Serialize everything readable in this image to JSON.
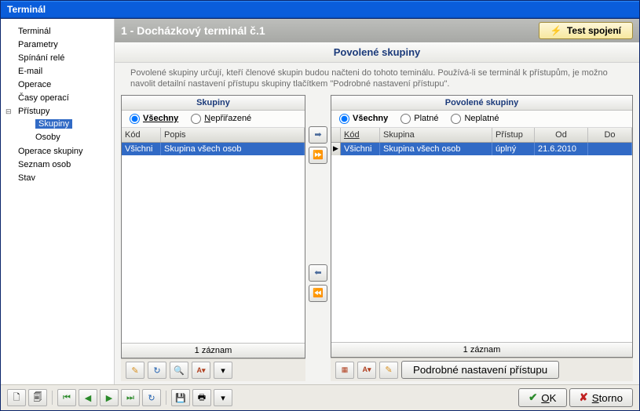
{
  "window_title": "Terminál",
  "sidebar": {
    "items": [
      {
        "label": "Terminál"
      },
      {
        "label": "Parametry"
      },
      {
        "label": "Spínání relé"
      },
      {
        "label": "E-mail"
      },
      {
        "label": "Operace"
      },
      {
        "label": "Časy operací"
      },
      {
        "label": "Přístupy",
        "children": [
          {
            "label": "Skupiny",
            "selected": true
          },
          {
            "label": "Osoby"
          }
        ]
      },
      {
        "label": "Operace skupiny"
      },
      {
        "label": "Seznam osob"
      },
      {
        "label": "Stav"
      }
    ]
  },
  "header": {
    "title": "1   -   Docházkový terminál č.1",
    "test_button": "Test spojení"
  },
  "sub_header": "Povolené skupiny",
  "info_text": "Povolené skupiny určují, kteří členové skupin budou načteni do tohoto teminálu. Používá-li se terminál k přístupům, je možno navolit detailní nastavení přístupu skupiny tlačítkem \"Podrobné nastavení přístupu\".",
  "left_panel": {
    "title": "Skupiny",
    "radios": {
      "all": "Všechny",
      "unassigned": "Nepřiřazené",
      "selected": "all"
    },
    "columns": {
      "code": "Kód",
      "desc": "Popis"
    },
    "row": {
      "code": "Všichni",
      "desc": "Skupina všech osob"
    },
    "footer": "1 záznam"
  },
  "right_panel": {
    "title": "Povolené skupiny",
    "radios": {
      "all": "Všechny",
      "valid": "Platné",
      "invalid": "Neplatné",
      "selected": "all"
    },
    "columns": {
      "code": "Kód",
      "group": "Skupina",
      "access": "Přístup",
      "from": "Od",
      "to": "Do"
    },
    "row": {
      "code": "Všichni",
      "group": "Skupina všech osob",
      "access": "úplný",
      "from": "21.6.2010",
      "to": ""
    },
    "footer": "1 záznam",
    "detail_button": "Podrobné nastavení přístupu"
  },
  "buttons": {
    "ok": "OK",
    "cancel": "Storno"
  }
}
